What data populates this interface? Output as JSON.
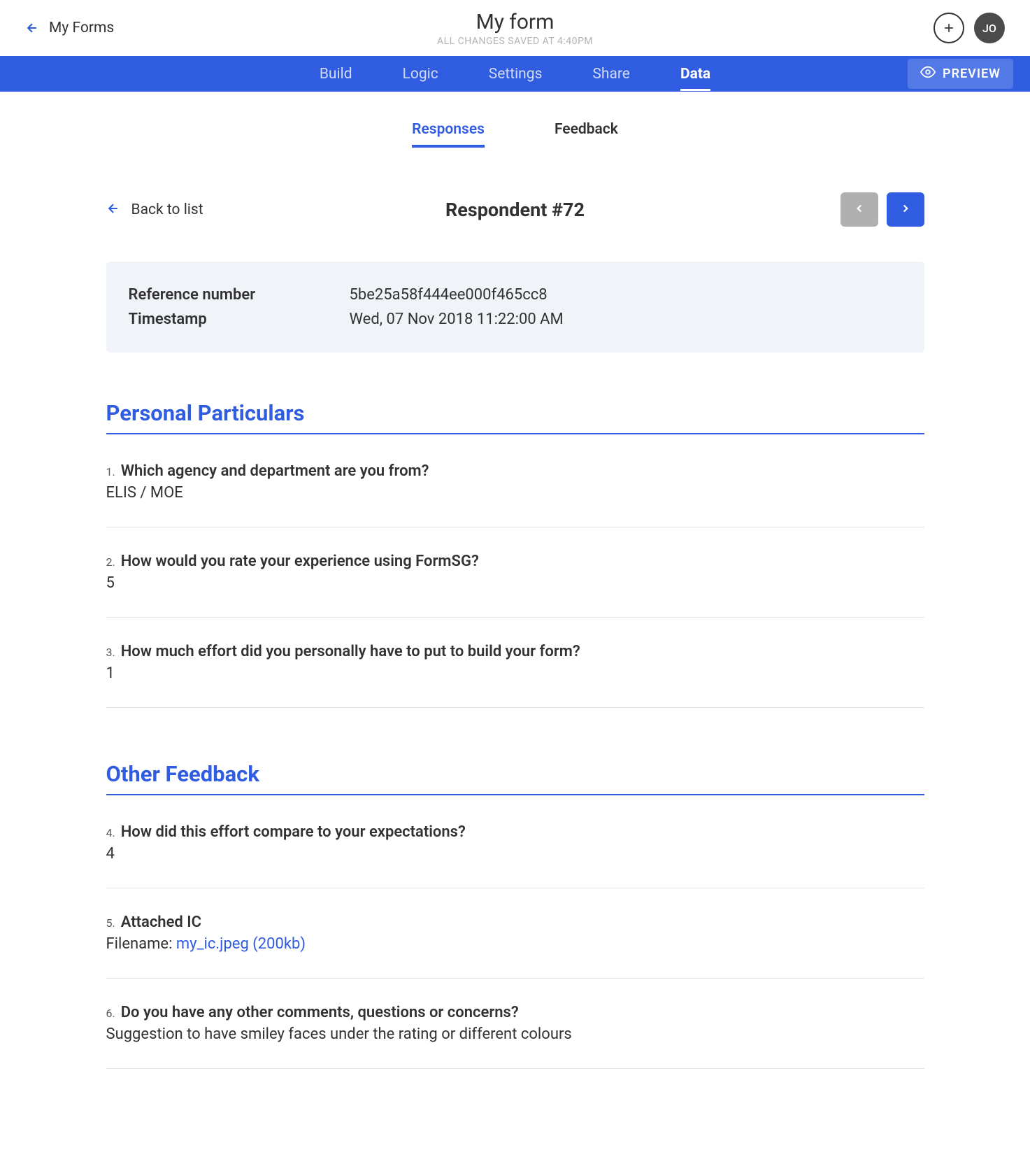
{
  "header": {
    "back_label": "My Forms",
    "title": "My form",
    "save_status": "All changes saved at 4:40pm",
    "avatar_initials": "JO"
  },
  "nav": {
    "tabs": [
      "Build",
      "Logic",
      "Settings",
      "Share",
      "Data"
    ],
    "active_index": 4,
    "preview_label": "PREVIEW"
  },
  "sub_tabs": {
    "items": [
      "Responses",
      "Feedback"
    ],
    "active_index": 0
  },
  "respondent": {
    "back_to_list": "Back to list",
    "title": "Respondent #72",
    "meta": {
      "reference_label": "Reference number",
      "reference_value": "5be25a58f444ee000f465cc8",
      "timestamp_label": "Timestamp",
      "timestamp_value": "Wed, 07 Nov 2018 11:22:00 AM"
    }
  },
  "sections": [
    {
      "title": "Personal Particulars",
      "questions": [
        {
          "num": "1.",
          "text": "Which agency and department are you from?",
          "answer": "ELIS / MOE"
        },
        {
          "num": "2.",
          "text": "How would you rate your experience using FormSG?",
          "answer": "5"
        },
        {
          "num": "3.",
          "text": "How much effort did you personally have to put to build your form?",
          "answer": "1"
        }
      ]
    },
    {
      "title": "Other Feedback",
      "questions": [
        {
          "num": "4.",
          "text": "How did this effort compare to your expectations?",
          "answer": "4"
        },
        {
          "num": "5.",
          "text": "Attached IC",
          "filename_label": "Filename: ",
          "filename_link": "my_ic.jpeg (200kb)"
        },
        {
          "num": "6.",
          "text": "Do you have any other comments, questions or concerns?",
          "answer": "Suggestion to have smiley faces under the rating or different colours"
        }
      ]
    }
  ]
}
